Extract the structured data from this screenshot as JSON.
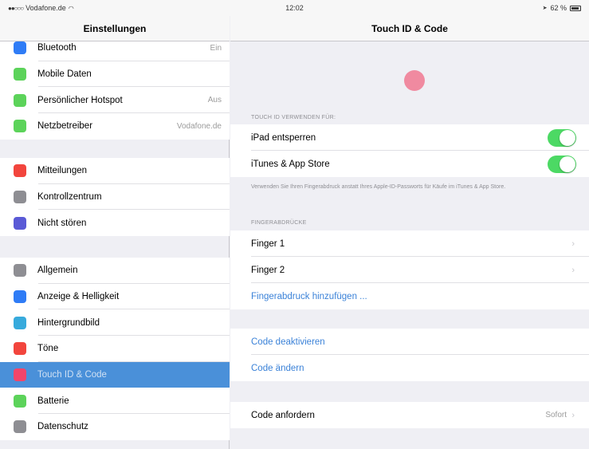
{
  "status_bar": {
    "carrier": "Vodafone.de",
    "time": "12:02",
    "battery": "62 %"
  },
  "master": {
    "title": "Einstellungen",
    "group1": [
      {
        "label": "Bluetooth",
        "value": "Ein",
        "icon": "bluetooth-icon",
        "color": "#2f7cf6"
      },
      {
        "label": "Mobile Daten",
        "value": "",
        "icon": "antenna-icon",
        "color": "#5cd35a"
      },
      {
        "label": "Persönlicher Hotspot",
        "value": "Aus",
        "icon": "hotspot-icon",
        "color": "#5cd35a"
      },
      {
        "label": "Netzbetreiber",
        "value": "Vodafone.de",
        "icon": "phone-icon",
        "color": "#5cd35a"
      }
    ],
    "group2": [
      {
        "label": "Mitteilungen",
        "icon": "notifications-icon",
        "color": "#f2453d"
      },
      {
        "label": "Kontrollzentrum",
        "icon": "control-center-icon",
        "color": "#8e8e93"
      },
      {
        "label": "Nicht stören",
        "icon": "moon-icon",
        "color": "#5a5ad6"
      }
    ],
    "group3": [
      {
        "label": "Allgemein",
        "icon": "gear-icon",
        "color": "#8e8e93"
      },
      {
        "label": "Anzeige & Helligkeit",
        "icon": "display-icon",
        "color": "#2f7cf6"
      },
      {
        "label": "Hintergrundbild",
        "icon": "wallpaper-icon",
        "color": "#37aadc"
      },
      {
        "label": "Töne",
        "icon": "speaker-icon",
        "color": "#f2453d"
      },
      {
        "label": "Touch ID & Code",
        "icon": "fingerprint-icon",
        "color": "#f2456a",
        "selected": true
      },
      {
        "label": "Batterie",
        "icon": "battery-icon",
        "color": "#5cd35a"
      },
      {
        "label": "Datenschutz",
        "icon": "hand-icon",
        "color": "#8e8e93"
      }
    ]
  },
  "detail": {
    "title": "Touch ID & Code",
    "section_use": "TOUCH ID VERWENDEN FÜR:",
    "ipad_unlock": "iPad entsperren",
    "itunes": "iTunes & App Store",
    "note": "Verwenden Sie Ihren Fingerabdruck anstatt Ihres Apple-ID-Passworts für Käufe im iTunes & App Store.",
    "section_fingers": "FINGERABDRÜCKE",
    "finger1": "Finger 1",
    "finger2": "Finger 2",
    "add_fingerprint": "Fingerabdruck hinzufügen ...",
    "code_disable": "Code deaktivieren",
    "code_change": "Code ändern",
    "code_require": "Code anfordern",
    "code_require_value": "Sofort"
  }
}
